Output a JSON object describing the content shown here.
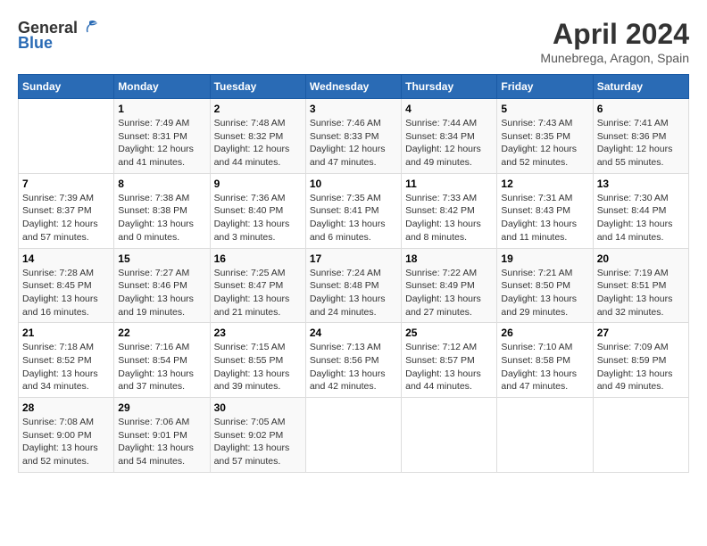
{
  "header": {
    "logo_general": "General",
    "logo_blue": "Blue",
    "title": "April 2024",
    "location": "Munebrega, Aragon, Spain"
  },
  "days_of_week": [
    "Sunday",
    "Monday",
    "Tuesday",
    "Wednesday",
    "Thursday",
    "Friday",
    "Saturday"
  ],
  "weeks": [
    [
      {
        "day": "",
        "sunrise": "",
        "sunset": "",
        "daylight": ""
      },
      {
        "day": "1",
        "sunrise": "Sunrise: 7:49 AM",
        "sunset": "Sunset: 8:31 PM",
        "daylight": "Daylight: 12 hours and 41 minutes."
      },
      {
        "day": "2",
        "sunrise": "Sunrise: 7:48 AM",
        "sunset": "Sunset: 8:32 PM",
        "daylight": "Daylight: 12 hours and 44 minutes."
      },
      {
        "day": "3",
        "sunrise": "Sunrise: 7:46 AM",
        "sunset": "Sunset: 8:33 PM",
        "daylight": "Daylight: 12 hours and 47 minutes."
      },
      {
        "day": "4",
        "sunrise": "Sunrise: 7:44 AM",
        "sunset": "Sunset: 8:34 PM",
        "daylight": "Daylight: 12 hours and 49 minutes."
      },
      {
        "day": "5",
        "sunrise": "Sunrise: 7:43 AM",
        "sunset": "Sunset: 8:35 PM",
        "daylight": "Daylight: 12 hours and 52 minutes."
      },
      {
        "day": "6",
        "sunrise": "Sunrise: 7:41 AM",
        "sunset": "Sunset: 8:36 PM",
        "daylight": "Daylight: 12 hours and 55 minutes."
      }
    ],
    [
      {
        "day": "7",
        "sunrise": "Sunrise: 7:39 AM",
        "sunset": "Sunset: 8:37 PM",
        "daylight": "Daylight: 12 hours and 57 minutes."
      },
      {
        "day": "8",
        "sunrise": "Sunrise: 7:38 AM",
        "sunset": "Sunset: 8:38 PM",
        "daylight": "Daylight: 13 hours and 0 minutes."
      },
      {
        "day": "9",
        "sunrise": "Sunrise: 7:36 AM",
        "sunset": "Sunset: 8:40 PM",
        "daylight": "Daylight: 13 hours and 3 minutes."
      },
      {
        "day": "10",
        "sunrise": "Sunrise: 7:35 AM",
        "sunset": "Sunset: 8:41 PM",
        "daylight": "Daylight: 13 hours and 6 minutes."
      },
      {
        "day": "11",
        "sunrise": "Sunrise: 7:33 AM",
        "sunset": "Sunset: 8:42 PM",
        "daylight": "Daylight: 13 hours and 8 minutes."
      },
      {
        "day": "12",
        "sunrise": "Sunrise: 7:31 AM",
        "sunset": "Sunset: 8:43 PM",
        "daylight": "Daylight: 13 hours and 11 minutes."
      },
      {
        "day": "13",
        "sunrise": "Sunrise: 7:30 AM",
        "sunset": "Sunset: 8:44 PM",
        "daylight": "Daylight: 13 hours and 14 minutes."
      }
    ],
    [
      {
        "day": "14",
        "sunrise": "Sunrise: 7:28 AM",
        "sunset": "Sunset: 8:45 PM",
        "daylight": "Daylight: 13 hours and 16 minutes."
      },
      {
        "day": "15",
        "sunrise": "Sunrise: 7:27 AM",
        "sunset": "Sunset: 8:46 PM",
        "daylight": "Daylight: 13 hours and 19 minutes."
      },
      {
        "day": "16",
        "sunrise": "Sunrise: 7:25 AM",
        "sunset": "Sunset: 8:47 PM",
        "daylight": "Daylight: 13 hours and 21 minutes."
      },
      {
        "day": "17",
        "sunrise": "Sunrise: 7:24 AM",
        "sunset": "Sunset: 8:48 PM",
        "daylight": "Daylight: 13 hours and 24 minutes."
      },
      {
        "day": "18",
        "sunrise": "Sunrise: 7:22 AM",
        "sunset": "Sunset: 8:49 PM",
        "daylight": "Daylight: 13 hours and 27 minutes."
      },
      {
        "day": "19",
        "sunrise": "Sunrise: 7:21 AM",
        "sunset": "Sunset: 8:50 PM",
        "daylight": "Daylight: 13 hours and 29 minutes."
      },
      {
        "day": "20",
        "sunrise": "Sunrise: 7:19 AM",
        "sunset": "Sunset: 8:51 PM",
        "daylight": "Daylight: 13 hours and 32 minutes."
      }
    ],
    [
      {
        "day": "21",
        "sunrise": "Sunrise: 7:18 AM",
        "sunset": "Sunset: 8:52 PM",
        "daylight": "Daylight: 13 hours and 34 minutes."
      },
      {
        "day": "22",
        "sunrise": "Sunrise: 7:16 AM",
        "sunset": "Sunset: 8:54 PM",
        "daylight": "Daylight: 13 hours and 37 minutes."
      },
      {
        "day": "23",
        "sunrise": "Sunrise: 7:15 AM",
        "sunset": "Sunset: 8:55 PM",
        "daylight": "Daylight: 13 hours and 39 minutes."
      },
      {
        "day": "24",
        "sunrise": "Sunrise: 7:13 AM",
        "sunset": "Sunset: 8:56 PM",
        "daylight": "Daylight: 13 hours and 42 minutes."
      },
      {
        "day": "25",
        "sunrise": "Sunrise: 7:12 AM",
        "sunset": "Sunset: 8:57 PM",
        "daylight": "Daylight: 13 hours and 44 minutes."
      },
      {
        "day": "26",
        "sunrise": "Sunrise: 7:10 AM",
        "sunset": "Sunset: 8:58 PM",
        "daylight": "Daylight: 13 hours and 47 minutes."
      },
      {
        "day": "27",
        "sunrise": "Sunrise: 7:09 AM",
        "sunset": "Sunset: 8:59 PM",
        "daylight": "Daylight: 13 hours and 49 minutes."
      }
    ],
    [
      {
        "day": "28",
        "sunrise": "Sunrise: 7:08 AM",
        "sunset": "Sunset: 9:00 PM",
        "daylight": "Daylight: 13 hours and 52 minutes."
      },
      {
        "day": "29",
        "sunrise": "Sunrise: 7:06 AM",
        "sunset": "Sunset: 9:01 PM",
        "daylight": "Daylight: 13 hours and 54 minutes."
      },
      {
        "day": "30",
        "sunrise": "Sunrise: 7:05 AM",
        "sunset": "Sunset: 9:02 PM",
        "daylight": "Daylight: 13 hours and 57 minutes."
      },
      {
        "day": "",
        "sunrise": "",
        "sunset": "",
        "daylight": ""
      },
      {
        "day": "",
        "sunrise": "",
        "sunset": "",
        "daylight": ""
      },
      {
        "day": "",
        "sunrise": "",
        "sunset": "",
        "daylight": ""
      },
      {
        "day": "",
        "sunrise": "",
        "sunset": "",
        "daylight": ""
      }
    ]
  ]
}
